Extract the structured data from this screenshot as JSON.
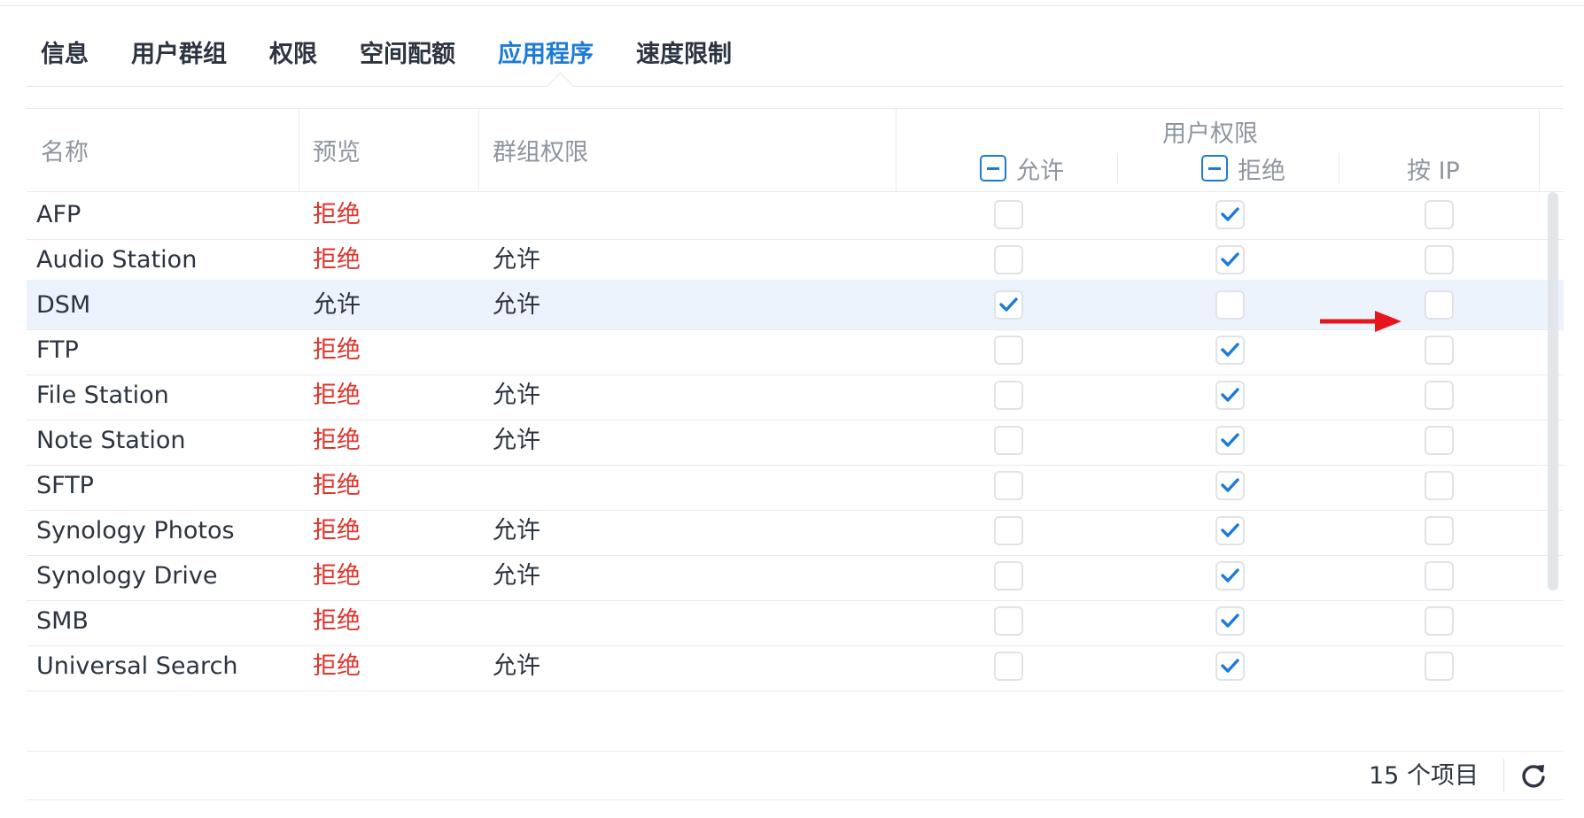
{
  "tabs": [
    {
      "label": "信息"
    },
    {
      "label": "用户群组"
    },
    {
      "label": "权限"
    },
    {
      "label": "空间配额"
    },
    {
      "label": "应用程序"
    },
    {
      "label": "速度限制"
    }
  ],
  "active_tab": "应用程序",
  "header": {
    "name": "名称",
    "preview": "预览",
    "group_permission": "群组权限",
    "user_permission": "用户权限",
    "allow": "允许",
    "deny": "拒绝",
    "by_ip": "按 IP"
  },
  "rows": [
    {
      "name": "AFP",
      "preview": "拒绝",
      "group": "",
      "allow": false,
      "deny": true,
      "by_ip": false
    },
    {
      "name": "Audio Station",
      "preview": "拒绝",
      "group": "允许",
      "allow": false,
      "deny": true,
      "by_ip": false
    },
    {
      "name": "DSM",
      "preview": "允许",
      "group": "允许",
      "allow": true,
      "deny": false,
      "by_ip": false
    },
    {
      "name": "FTP",
      "preview": "拒绝",
      "group": "",
      "allow": false,
      "deny": true,
      "by_ip": false
    },
    {
      "name": "File Station",
      "preview": "拒绝",
      "group": "允许",
      "allow": false,
      "deny": true,
      "by_ip": false
    },
    {
      "name": "Note Station",
      "preview": "拒绝",
      "group": "允许",
      "allow": false,
      "deny": true,
      "by_ip": false
    },
    {
      "name": "SFTP",
      "preview": "拒绝",
      "group": "",
      "allow": false,
      "deny": true,
      "by_ip": false
    },
    {
      "name": "Synology Photos",
      "preview": "拒绝",
      "group": "允许",
      "allow": false,
      "deny": true,
      "by_ip": false
    },
    {
      "name": "Synology Drive",
      "preview": "拒绝",
      "group": "允许",
      "allow": false,
      "deny": true,
      "by_ip": false
    },
    {
      "name": "SMB",
      "preview": "拒绝",
      "group": "",
      "allow": false,
      "deny": true,
      "by_ip": false
    },
    {
      "name": "Universal Search",
      "preview": "拒绝",
      "group": "允许",
      "allow": false,
      "deny": true,
      "by_ip": false
    }
  ],
  "selected_row": "DSM",
  "footer": {
    "count_label": "15 个项目"
  },
  "icons": {
    "refresh": "refresh-icon",
    "check": "checkmark-icon",
    "annotation": "red-arrow-icon"
  },
  "colors": {
    "accent": "#1c7ad8",
    "deny": "#e0332b",
    "selected_row": "#ecf3fc",
    "annotation": "#e8141c"
  }
}
